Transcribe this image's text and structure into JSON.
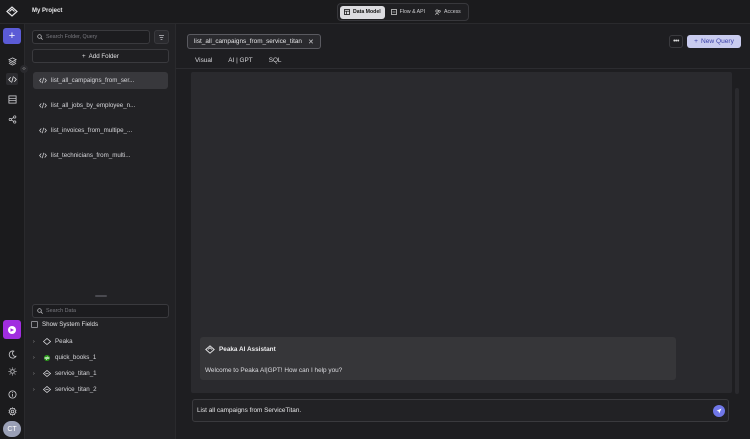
{
  "topbar": {
    "project_name": "My Project",
    "modes": [
      {
        "label": "Data Model",
        "active": true
      },
      {
        "label": "Flow & API",
        "active": false
      },
      {
        "label": "Access",
        "active": false
      }
    ]
  },
  "rail": {
    "avatar_initials": "CT",
    "icons": [
      "plus-icon",
      "layers-icon",
      "code-icon",
      "list-icon",
      "share-icon",
      "app-icon",
      "moon-icon",
      "sun-icon",
      "info-icon",
      "gear-icon"
    ]
  },
  "sidebar": {
    "search_placeholder": "Search Folder, Query",
    "add_folder_label": "Add Folder",
    "queries": [
      {
        "label": "list_all_campaigns_from_ser...",
        "active": true
      },
      {
        "label": "list_all_jobs_by_employee_n...",
        "active": false
      },
      {
        "label": "list_invoices_from_multipe_...",
        "active": false
      },
      {
        "label": "list_technicians_from_multi...",
        "active": false
      }
    ],
    "data_search_placeholder": "Search Data",
    "show_system_fields_label": "Show System Fields",
    "sources": [
      {
        "label": "Peaka",
        "icon": "peaka-logo-icon"
      },
      {
        "label": "quick_books_1",
        "icon": "quickbooks-icon"
      },
      {
        "label": "service_titan_1",
        "icon": "servicetitan-icon"
      },
      {
        "label": "service_titan_2",
        "icon": "servicetitan-icon"
      }
    ]
  },
  "main": {
    "open_tab": "list_all_campaigns_from_service_titan",
    "new_query_label": "New Query",
    "subtabs": [
      {
        "label": "Visual",
        "active": false
      },
      {
        "label": "AI | GPT",
        "active": true
      },
      {
        "label": "SQL",
        "active": false
      }
    ],
    "assistant_name": "Peaka AI Assistant",
    "assistant_message": "Welcome to Peaka AI|GPT! How can I help you?",
    "input_value": "List all campaigns from ServiceTitan."
  }
}
